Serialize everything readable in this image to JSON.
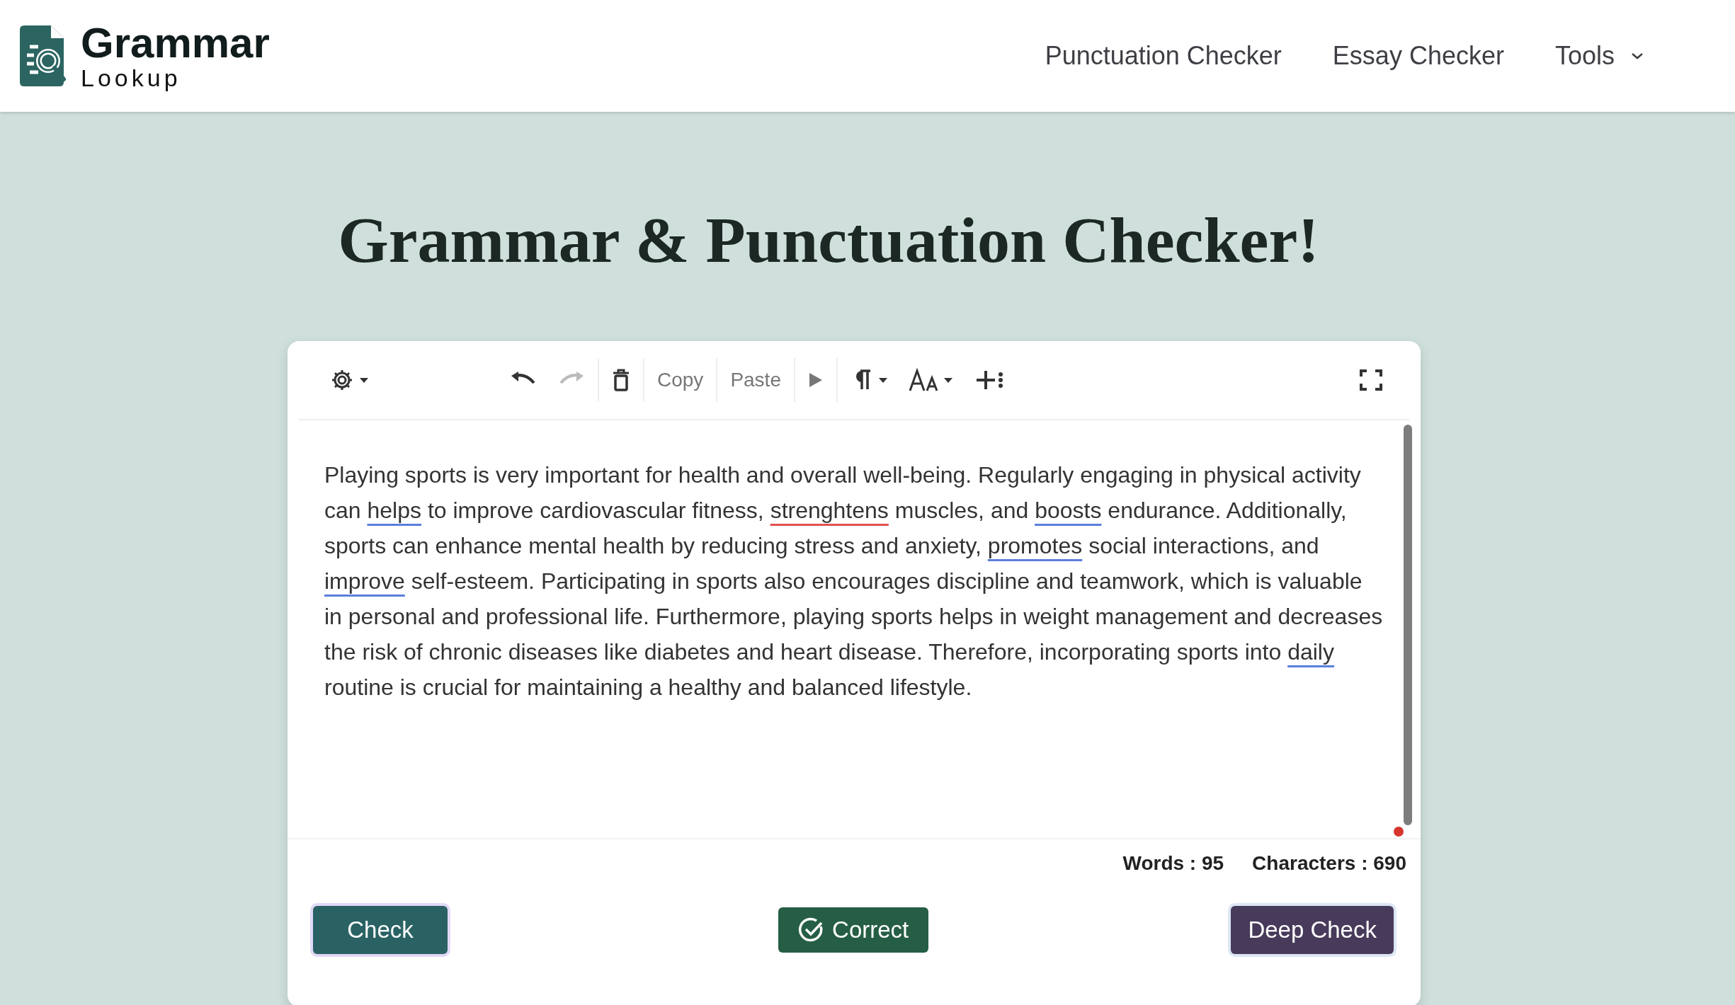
{
  "brand": {
    "name": "Grammar",
    "tagline": "Lookup"
  },
  "nav": [
    {
      "label": "Punctuation Checker",
      "dropdown": false
    },
    {
      "label": "Essay Checker",
      "dropdown": false
    },
    {
      "label": "Tools",
      "dropdown": true
    }
  ],
  "heading": "Grammar & Punctuation Checker!",
  "toolbar": {
    "undo": {
      "disabled": false
    },
    "redo": {
      "disabled": true
    },
    "copy": "Copy",
    "paste": "Paste"
  },
  "editor": {
    "lines": [
      [
        {
          "text": "Playing sports is very important for health and overall well-being. Regularly engaging in physical activity",
          "kind": "plain"
        }
      ],
      [
        {
          "text": "can ",
          "kind": "plain"
        },
        {
          "text": "helps",
          "kind": "suggestion"
        },
        {
          "text": " to improve cardiovascular fitness, ",
          "kind": "plain"
        },
        {
          "text": "strenghtens",
          "kind": "spelling"
        },
        {
          "text": " muscles, and ",
          "kind": "plain"
        },
        {
          "text": "boosts",
          "kind": "suggestion"
        },
        {
          "text": " endurance. Additionally,",
          "kind": "plain"
        }
      ],
      [
        {
          "text": "sports can enhance mental health by reducing stress and anxiety, ",
          "kind": "plain"
        },
        {
          "text": "promotes",
          "kind": "suggestion"
        },
        {
          "text": " social interactions, and",
          "kind": "plain"
        }
      ],
      [
        {
          "text": "improve",
          "kind": "suggestion"
        },
        {
          "text": " self-esteem. Participating in sports also encourages discipline and teamwork, which is valuable",
          "kind": "plain"
        }
      ],
      [
        {
          "text": "in personal and professional life. Furthermore, playing sports helps in weight management and decreases",
          "kind": "plain"
        }
      ],
      [
        {
          "text": "the risk of chronic diseases like diabetes and heart disease. Therefore, incorporating sports into ",
          "kind": "plain"
        },
        {
          "text": "daily",
          "kind": "suggestion"
        }
      ],
      [
        {
          "text": "routine is crucial for maintaining a healthy and balanced lifestyle.",
          "kind": "plain"
        }
      ]
    ]
  },
  "counts": [
    "Words : 95",
    "Characters : 690"
  ],
  "actions": [
    {
      "label": "Check",
      "kind": "check"
    },
    {
      "label": "Correct",
      "kind": "correct"
    },
    {
      "label": "Deep Check",
      "kind": "deep"
    }
  ]
}
